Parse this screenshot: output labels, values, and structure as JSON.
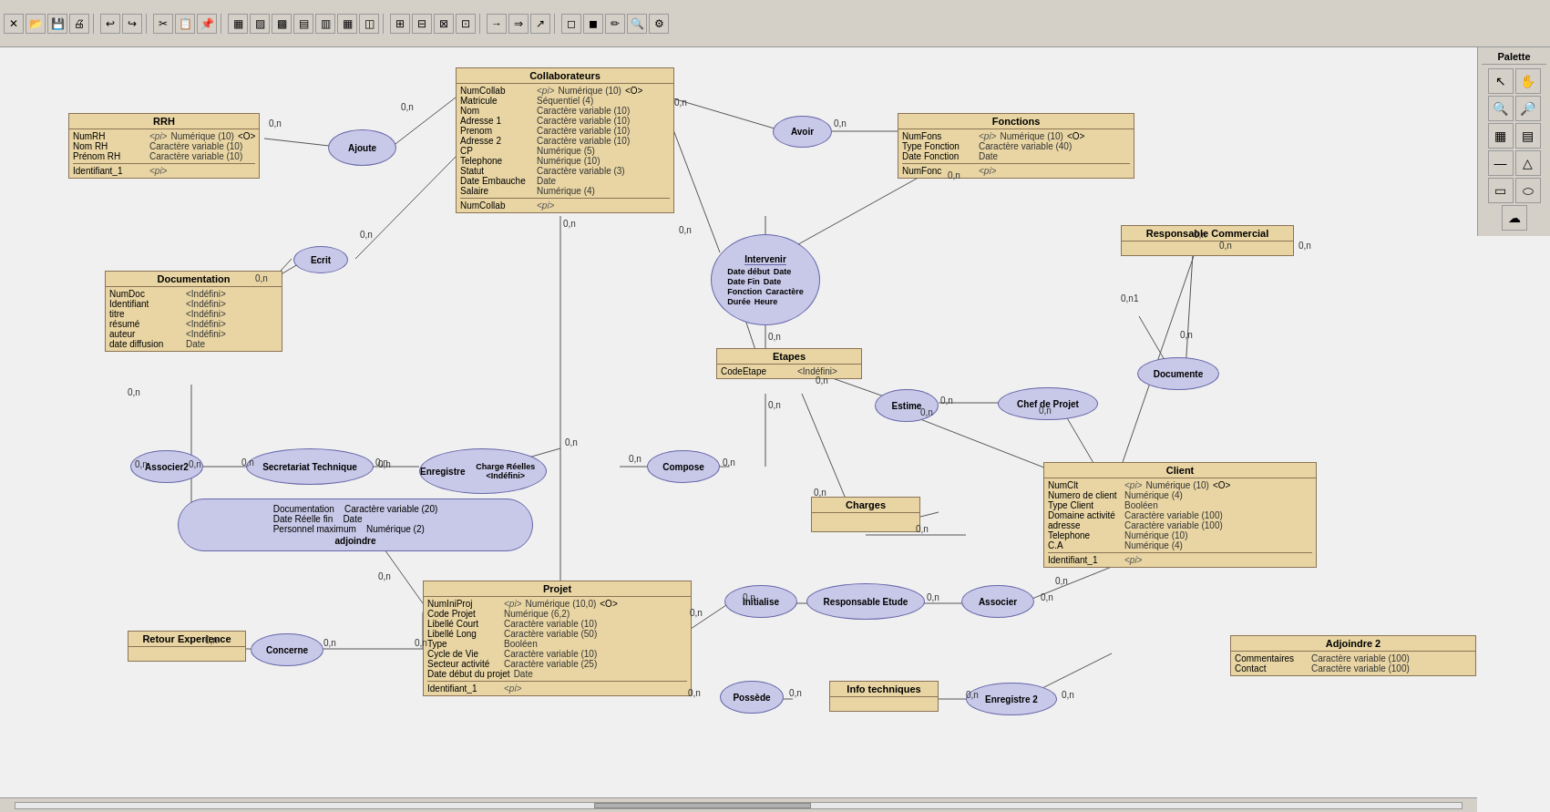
{
  "toolbar": {
    "buttons": [
      "✕",
      "⬜",
      "↩",
      "↪",
      "⬜",
      "⬜",
      "⬜",
      "⬜",
      "⬜",
      "⬜",
      "⬜",
      "⬜",
      "⬜",
      "⬜",
      "⬜",
      "⬜",
      "⬜",
      "⬜",
      "⬜",
      "⬜",
      "⬜",
      "⬜",
      "⬜",
      "⬜",
      "⬜",
      "⬜",
      "⬜",
      "⬜",
      "⬜",
      "⬜",
      "⬜"
    ]
  },
  "palette": {
    "title": "Palette"
  },
  "entities": {
    "collaborateurs": {
      "title": "Collaborateurs",
      "fields": [
        {
          "name": "NumCollab",
          "pk": "<pi>",
          "type": "Numérique (10)",
          "extra": "<O>"
        },
        {
          "name": "Matricule",
          "pk": "",
          "type": "Séquentiel (4)"
        },
        {
          "name": "Nom",
          "pk": "",
          "type": "Caractère variable (10)"
        },
        {
          "name": "Adresse 1",
          "pk": "",
          "type": "Caractère variable (10)"
        },
        {
          "name": "Prenom",
          "pk": "",
          "type": "Caractère variable (10)"
        },
        {
          "name": "Adresse 2",
          "pk": "",
          "type": "Caractère variable (10)"
        },
        {
          "name": "CP",
          "pk": "",
          "type": "Numérique (5)"
        },
        {
          "name": "Telephone",
          "pk": "",
          "type": "Numérique (10)"
        },
        {
          "name": "Statut",
          "pk": "",
          "type": "Caractère variable (3)"
        },
        {
          "name": "Date Embauche",
          "pk": "",
          "type": "Date"
        },
        {
          "name": "Salaire",
          "pk": "",
          "type": "Numérique (4)"
        },
        {
          "name": "NumCollab",
          "pk": "<pi>",
          "type": ""
        }
      ]
    },
    "rrh": {
      "title": "RRH",
      "fields": [
        {
          "name": "NumRH",
          "pk": "<pi>",
          "type": "Numérique (10)",
          "extra": "<O>"
        },
        {
          "name": "Nom RH",
          "pk": "",
          "type": "Caractère variable (10)"
        },
        {
          "name": "Prénom RH",
          "pk": "",
          "type": "Caractère variable (10)"
        },
        {
          "name": "Identifiant_1",
          "pk": "<pi>",
          "type": ""
        }
      ]
    },
    "fonctions": {
      "title": "Fonctions",
      "fields": [
        {
          "name": "NumFons",
          "pk": "<pi>",
          "type": "Numérique (10)",
          "extra": "<O>"
        },
        {
          "name": "Type Fonction",
          "pk": "",
          "type": "Caractère variable (40)"
        },
        {
          "name": "Date Fonction",
          "pk": "",
          "type": "Date"
        },
        {
          "name": "NumFonc",
          "pk": "<pi>",
          "type": ""
        }
      ]
    },
    "documentation": {
      "title": "Documentation",
      "fields": [
        {
          "name": "NumDoc",
          "pk": "",
          "type": "<Indéfini>"
        },
        {
          "name": "Identifiant",
          "pk": "",
          "type": "<Indéfini>"
        },
        {
          "name": "titre",
          "pk": "",
          "type": "<Indéfini>"
        },
        {
          "name": "résumé",
          "pk": "",
          "type": "<Indéfini>"
        },
        {
          "name": "auteur",
          "pk": "",
          "type": "<Indéfini>"
        },
        {
          "name": "date diffusion",
          "pk": "",
          "type": "Date"
        }
      ]
    },
    "etapes": {
      "title": "Etapes",
      "fields": [
        {
          "name": "CodeEtape",
          "pk": "",
          "type": "<Indéfini>"
        }
      ]
    },
    "client": {
      "title": "Client",
      "fields": [
        {
          "name": "NumClt",
          "pk": "<pi>",
          "type": "Numérique (10)",
          "extra": "<O>"
        },
        {
          "name": "Numero de client",
          "pk": "",
          "type": "Numérique (4)"
        },
        {
          "name": "Type Client",
          "pk": "",
          "type": "Booléen"
        },
        {
          "name": "Domaine activité",
          "pk": "",
          "type": "Caractère variable (100)"
        },
        {
          "name": "adresse",
          "pk": "",
          "type": "Caractère variable (100)"
        },
        {
          "name": "Telephone",
          "pk": "",
          "type": "Numérique (10)"
        },
        {
          "name": "C.A",
          "pk": "",
          "type": "Numérique (4)"
        },
        {
          "name": "Identifiant_1",
          "pk": "<pi>",
          "type": ""
        }
      ]
    },
    "projet": {
      "title": "Projet",
      "fields": [
        {
          "name": "NumIniProj",
          "pk": "<pi>",
          "type": "Numérique (10,0)",
          "extra": "<O>"
        },
        {
          "name": "Code Projet",
          "pk": "",
          "type": "Numérique (6,2)"
        },
        {
          "name": "Libellé Court",
          "pk": "",
          "type": "Caractère variable (10)"
        },
        {
          "name": "Libellé Long",
          "pk": "",
          "type": "Caractère variable (50)"
        },
        {
          "name": "Type",
          "pk": "",
          "type": "Booléen"
        },
        {
          "name": "Cycle de Vie",
          "pk": "",
          "type": "Caractère variable (10)"
        },
        {
          "name": "Secteur activité",
          "pk": "",
          "type": "Caractère variable (25)"
        },
        {
          "name": "Date début du projet",
          "pk": "",
          "type": "Date"
        },
        {
          "name": "Identifiant_1",
          "pk": "<pi>",
          "type": ""
        }
      ]
    },
    "charges": {
      "title": "Charges",
      "fields": []
    },
    "info_techniques": {
      "title": "Info techniques",
      "fields": []
    },
    "responsable_commercial": {
      "title": "Responsable Commercial",
      "fields": []
    },
    "retour_experience": {
      "title": "Retour Experience",
      "fields": []
    },
    "adjoindre2": {
      "title": "Adjoindre 2",
      "fields": [
        {
          "name": "Commentaires",
          "pk": "",
          "type": "Caractère variable (100)"
        },
        {
          "name": "Contact",
          "pk": "",
          "type": "Caractère variable (100)"
        }
      ]
    }
  },
  "relations": {
    "ajoute": "Ajoute",
    "avoir": "Avoir",
    "ecrit": "Ecrit",
    "intervenir": "Intervenir",
    "enregistre": "Enregistre",
    "compose": "Compose",
    "associer2": "Associer2",
    "secretariat_technique": "Secretariat Technique",
    "estime": "Estime",
    "chef_de_projet": "Chef de Projet",
    "documente": "Documente",
    "initialise": "Initialise",
    "responsable_etude": "Responsable Etude",
    "associer": "Associer",
    "concerne": "Concerne",
    "possede": "Possède",
    "enregistre2": "Enregistre 2"
  },
  "intervenir_attrs": {
    "date_debut": "Date début",
    "date_fin": "Date Fin",
    "fonction": "Fonction",
    "duree": "Durée",
    "date_type": "Date",
    "date_type2": "Date",
    "char_type": "Caractère",
    "heure_type": "Heure"
  },
  "enregistre_attrs": {
    "charge": "Charge Réelles",
    "type": "<Indéfini>"
  },
  "adjoindre_attrs": {
    "documentation": "Documentation",
    "date_reelle": "Date Réelle fin",
    "personnel": "Personnel maximum",
    "char20": "Caractère variable (20)",
    "date": "Date",
    "num2": "Numérique (2)"
  }
}
